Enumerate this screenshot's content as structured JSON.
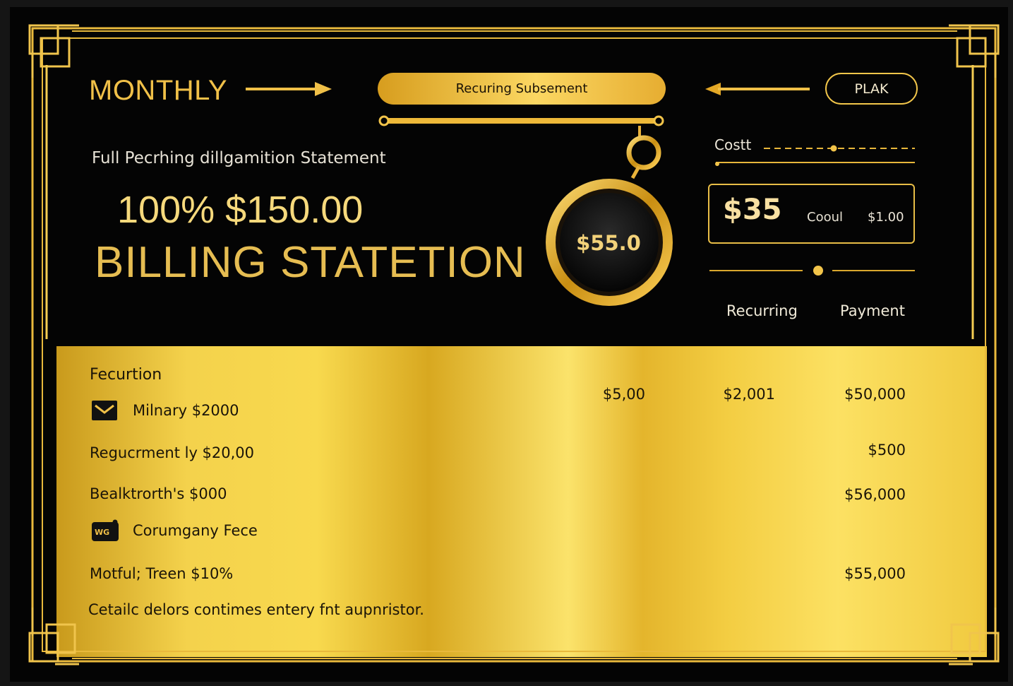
{
  "header": {
    "monthly": "MONTHLY",
    "pill_label": "Recuring Subsement",
    "plak_label": "PLAK",
    "subtitle": "Full Pecrhing dillgamition Statement",
    "headline_amount": "100% $150.00",
    "headline_title": "BILLING STATETION"
  },
  "pendant": {
    "value": "$55.0"
  },
  "side_panel": {
    "cost_label": "Costt",
    "amount": "$35",
    "small_label": "Cooul",
    "small_value": "$1.00",
    "col_recurring": "Recurring",
    "col_payment": "Payment"
  },
  "table": {
    "section_title": "Fecurtion",
    "rows": [
      {
        "label": "Milnary $2000",
        "icon": "envelope-icon",
        "col1": "$5,00",
        "col2": "$2,001",
        "col3": "$50,000"
      },
      {
        "label": "Regucrment ly $20,00",
        "col3": "$500"
      },
      {
        "label": "Bealktrorth's $000",
        "col3": "$56,000"
      },
      {
        "label": "Corumgany Fece",
        "icon": "card-wallet-icon"
      },
      {
        "label": "Motful; Treen $10%",
        "col3": "$55,000"
      }
    ],
    "footnote": "Cetailc delors contimes entery fnt aupnristor."
  },
  "colors": {
    "gold": "#f0c048",
    "gold_light": "#f8d94e",
    "black": "#040404"
  }
}
